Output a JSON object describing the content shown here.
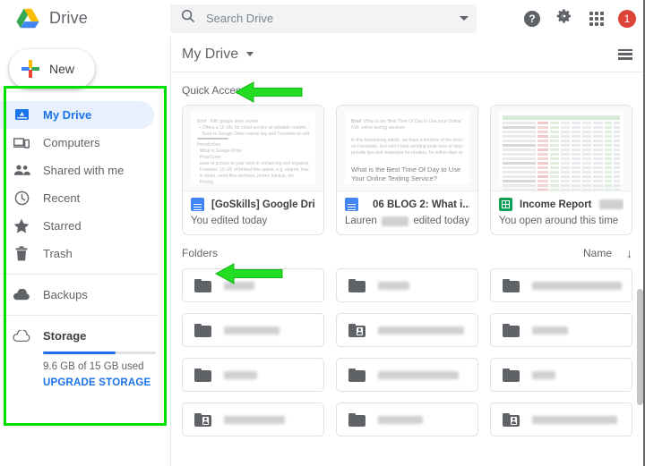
{
  "app": {
    "brand_name": "Drive",
    "logo_icon": "google-drive-logo"
  },
  "search": {
    "placeholder": "Search Drive",
    "value": "",
    "search_icon": "search-icon",
    "options_icon": "chevron-down-icon"
  },
  "topbar": {
    "help_icon": "help-icon",
    "help_glyph": "?",
    "settings_icon": "gear-icon",
    "apps_icon": "apps-grid-icon",
    "avatar_icon": "account-avatar",
    "notification_count": "1"
  },
  "sidebar": {
    "new_button": {
      "label": "New",
      "icon": "plus-icon"
    },
    "items": [
      {
        "label": "My Drive",
        "icon": "drive-icon",
        "active": true
      },
      {
        "label": "Computers",
        "icon": "computer-icon",
        "active": false
      },
      {
        "label": "Shared with me",
        "icon": "people-icon",
        "active": false
      },
      {
        "label": "Recent",
        "icon": "clock-icon",
        "active": false
      },
      {
        "label": "Starred",
        "icon": "star-icon",
        "active": false
      },
      {
        "label": "Trash",
        "icon": "trash-icon",
        "active": false
      },
      {
        "label": "Backups",
        "icon": "cloud-filled-icon",
        "active": false
      }
    ],
    "storage": {
      "label": "Storage",
      "icon": "cloud-outline-icon",
      "used_text": "9.6 GB of 15 GB used",
      "percent": 64,
      "upgrade_label": "UPGRADE STORAGE"
    }
  },
  "breadcrumb": {
    "title": "My Drive",
    "caret_icon": "chevron-down-icon",
    "list_view_icon": "list-view-icon"
  },
  "main": {
    "quick_access": {
      "heading": "Quick Access",
      "cards": [
        {
          "title": "[GoSkills] Google Drive R...",
          "subtitle": "You edited today",
          "icon": "google-docs-icon",
          "thumb_type": "document",
          "title_redacted": false,
          "subtitle_redacted": false
        },
        {
          "title": "06 BLOG 2: What i...",
          "title_prefix_redacted": true,
          "subtitle_prefix": "Lauren",
          "subtitle_suffix": "edited today",
          "subtitle_redacted": true,
          "icon": "google-docs-icon",
          "thumb_type": "document-blog",
          "thumb_heading": "What is the Best Time Of Day to Use Your Online Texting Service?"
        },
        {
          "title": "Income Report",
          "title_suffix_redacted": true,
          "subtitle": "You open around this time",
          "icon": "google-sheets-icon",
          "thumb_type": "spreadsheet",
          "subtitle_redacted": false
        }
      ]
    },
    "folders": {
      "heading": "Folders",
      "sort_label": "Name",
      "sort_direction_icon": "arrow-down-icon",
      "items": [
        {
          "icon": "folder-icon",
          "name_redacted": true,
          "name_width": 34
        },
        {
          "icon": "folder-icon",
          "name_redacted": true,
          "name_width": 35
        },
        {
          "icon": "folder-icon",
          "name_redacted": true,
          "name_width": 100
        },
        {
          "icon": "folder-icon",
          "name_redacted": true,
          "name_width": 62
        },
        {
          "icon": "folder-shared-icon",
          "name_redacted": true,
          "name_width": 96
        },
        {
          "icon": "folder-icon",
          "name_redacted": true,
          "name_width": 40
        },
        {
          "icon": "folder-icon",
          "name_redacted": true,
          "name_width": 37
        },
        {
          "icon": "folder-icon",
          "name_redacted": true,
          "name_width": 90
        },
        {
          "icon": "folder-icon",
          "name_redacted": true,
          "name_width": 26
        },
        {
          "icon": "folder-shared-icon",
          "name_redacted": true,
          "name_width": 68
        },
        {
          "icon": "folder-icon",
          "name_redacted": true,
          "name_width": 50
        },
        {
          "icon": "folder-shared-icon",
          "name_redacted": true,
          "name_width": 95
        }
      ]
    }
  },
  "annotations": {
    "color": "#22dd22",
    "box_color": "#00e000",
    "arrows": [
      {
        "target": "quick-access-heading"
      },
      {
        "target": "folders-heading"
      }
    ],
    "highlight_box_target": "sidebar"
  }
}
